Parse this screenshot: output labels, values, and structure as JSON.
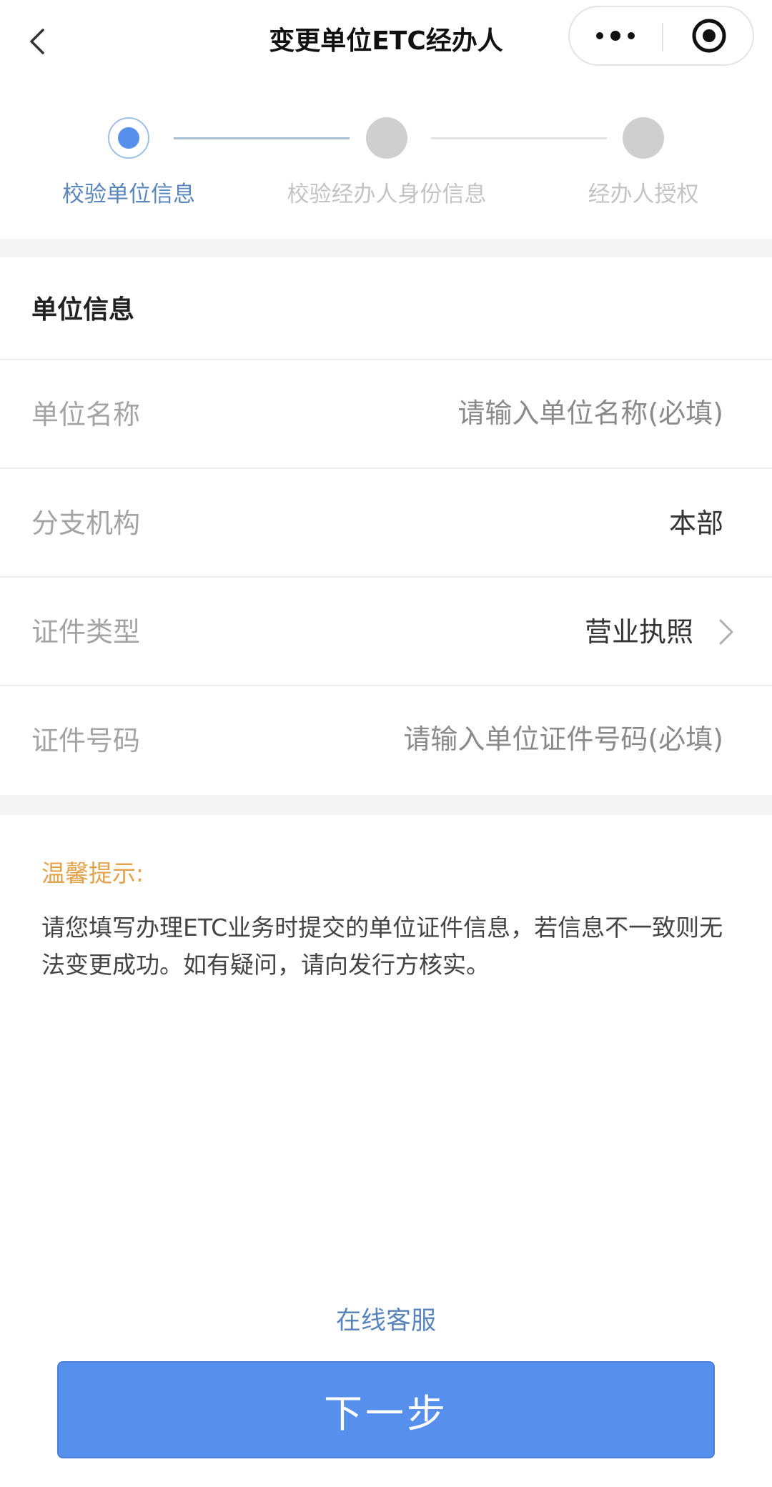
{
  "header": {
    "title": "变更单位ETC经办人",
    "back_icon": "chevron-left-icon",
    "more_icon": "more-dots-icon",
    "close_icon": "target-close-icon"
  },
  "steps": [
    {
      "label": "校验单位信息",
      "active": true
    },
    {
      "label": "校验经办人身份信息",
      "active": false
    },
    {
      "label": "经办人授权",
      "active": false
    }
  ],
  "form": {
    "section_title": "单位信息",
    "fields": [
      {
        "label": "单位名称",
        "placeholder": "请输入单位名称(必填)",
        "value": ""
      },
      {
        "label": "分支机构",
        "value": "本部"
      },
      {
        "label": "证件类型",
        "value": "营业执照"
      },
      {
        "label": "证件号码",
        "placeholder": "请输入单位证件号码(必填)",
        "value": ""
      }
    ]
  },
  "tips": {
    "title": "温馨提示:",
    "text": "请您填写办理ETC业务时提交的单位证件信息，若信息不一致则无法变更成功。如有疑问，请向发行方核实。"
  },
  "footer": {
    "service_link": "在线客服",
    "next_button": "下一步"
  },
  "colors": {
    "primary": "#5790ec",
    "link": "#5a86bd",
    "tip_title": "#e4a24b",
    "inactive": "#cfcfcf"
  }
}
